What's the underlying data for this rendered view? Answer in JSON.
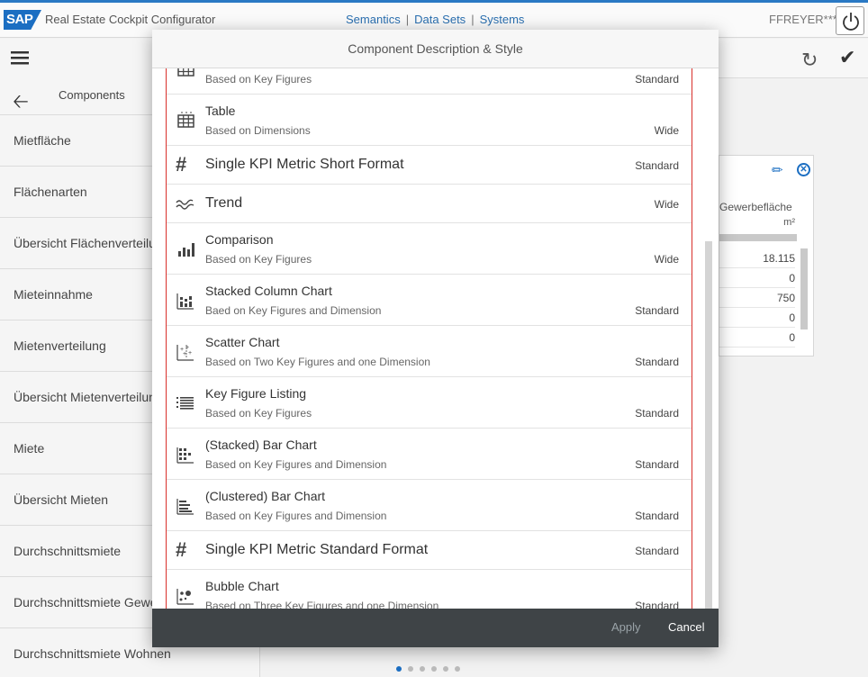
{
  "shell": {
    "logo": "SAP",
    "app_title": "Real Estate Cockpit Configurator",
    "nav": [
      "Semantics",
      "Data Sets",
      "Systems"
    ],
    "user": "FFREYER***"
  },
  "sidebar": {
    "back_label": "Components",
    "items": [
      "Mietfläche",
      "Flächenarten",
      "Übersicht Flächenverteilung",
      "Mieteinnahme",
      "Mietenverteilung",
      "Übersicht Mietenverteilung",
      "Miete",
      "Übersicht Mieten",
      "Durchschnittsmiete",
      "Durchschnittsmiete Gewerbe",
      "Durchschnittsmiete Wohnen"
    ]
  },
  "tile": {
    "column_header": "Gewerbefläche",
    "unit": "m²",
    "values": [
      "18.115",
      "0",
      "750",
      "0",
      "0"
    ]
  },
  "dialog": {
    "title": "Component Description & Style",
    "apply_label": "Apply",
    "cancel_label": "Cancel",
    "rows": [
      {
        "icon": "table-icon",
        "title": "",
        "subtitle": "Based on Key Figures",
        "size": "Standard"
      },
      {
        "icon": "table-icon",
        "title": "Table",
        "subtitle": "Based on Dimensions",
        "size": "Wide"
      },
      {
        "icon": "hash-icon",
        "title": "Single KPI Metric Short Format",
        "subtitle": "",
        "size": "Standard"
      },
      {
        "icon": "trend-icon",
        "title": "Trend",
        "subtitle": "",
        "size": "Wide"
      },
      {
        "icon": "comparison-icon",
        "title": "Comparison",
        "subtitle": "Based on Key Figures",
        "size": "Wide"
      },
      {
        "icon": "stacked-column-icon",
        "title": "Stacked Column Chart",
        "subtitle": "Baed on Key Figures and Dimension",
        "size": "Standard"
      },
      {
        "icon": "scatter-icon",
        "title": "Scatter Chart",
        "subtitle": "Based on Two Key Figures and one Dimension",
        "size": "Standard"
      },
      {
        "icon": "list-icon",
        "title": "Key Figure Listing",
        "subtitle": "Based on Key Figures",
        "size": "Standard"
      },
      {
        "icon": "stacked-bar-icon",
        "title": "(Stacked) Bar Chart",
        "subtitle": "Based on Key Figures and Dimension",
        "size": "Standard"
      },
      {
        "icon": "clustered-bar-icon",
        "title": "(Clustered) Bar Chart",
        "subtitle": "Based on Key Figures and Dimension",
        "size": "Standard"
      },
      {
        "icon": "hash-icon",
        "title": "Single KPI Metric Standard Format",
        "subtitle": "",
        "size": "Standard"
      },
      {
        "icon": "bubble-icon",
        "title": "Bubble Chart",
        "subtitle": "Based on Three Key Figures and one Dimension",
        "size": "Standard"
      }
    ]
  },
  "colors": {
    "accent": "#1b6ec2",
    "selection_border": "#d9302b",
    "footer": "#3f4447"
  }
}
